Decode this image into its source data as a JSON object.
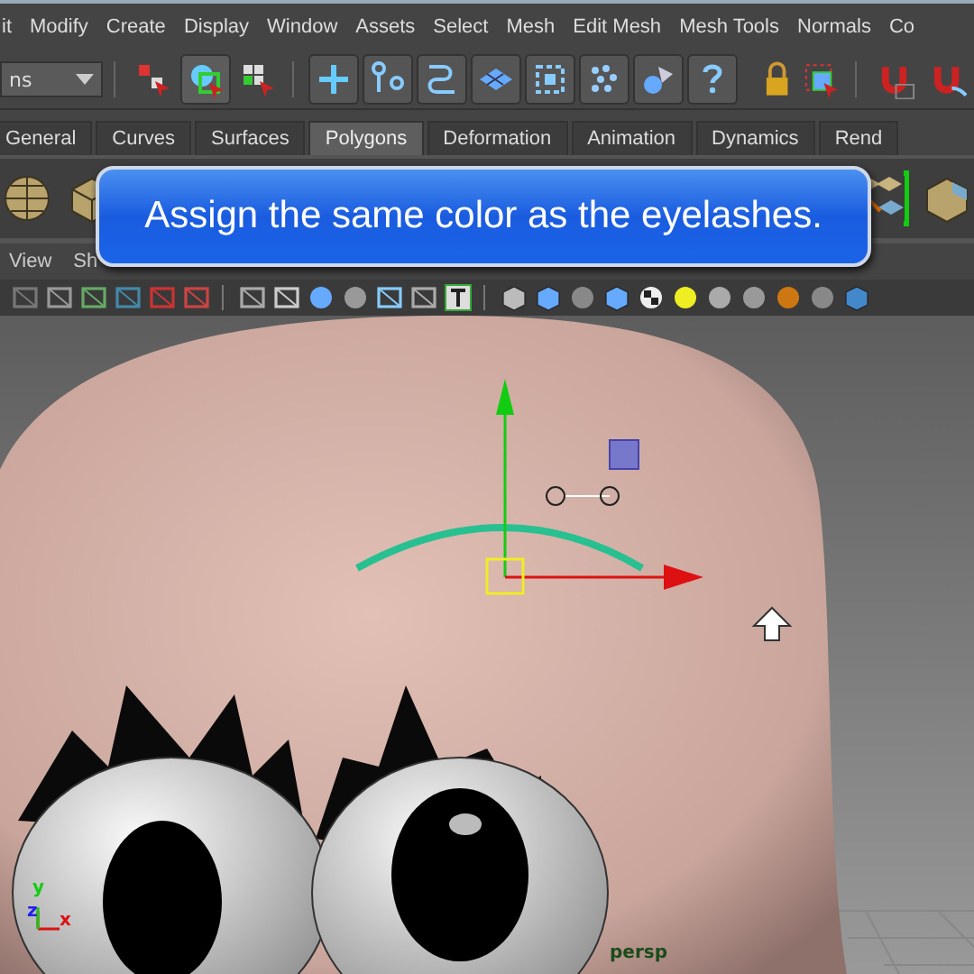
{
  "menu_bar": {
    "items": [
      "it",
      "Modify",
      "Create",
      "Display",
      "Window",
      "Assets",
      "Select",
      "Mesh",
      "Edit Mesh",
      "Mesh Tools",
      "Normals",
      "Co"
    ]
  },
  "status_line": {
    "menu_set": {
      "value": "ns"
    }
  },
  "shelf": {
    "tabs": [
      {
        "label": "General",
        "selected": false
      },
      {
        "label": "Curves",
        "selected": false
      },
      {
        "label": "Surfaces",
        "selected": false
      },
      {
        "label": "Polygons",
        "selected": true
      },
      {
        "label": "Deformation",
        "selected": false
      },
      {
        "label": "Animation",
        "selected": false
      },
      {
        "label": "Dynamics",
        "selected": false
      },
      {
        "label": "Rend",
        "selected": false
      }
    ]
  },
  "panel_menu": {
    "items": [
      "View",
      "Sh"
    ]
  },
  "viewport": {
    "axis_labels": [
      "y",
      "z",
      "x"
    ],
    "camera_label": "persp"
  },
  "callout": {
    "text": "Assign the same color as the eyelashes."
  }
}
